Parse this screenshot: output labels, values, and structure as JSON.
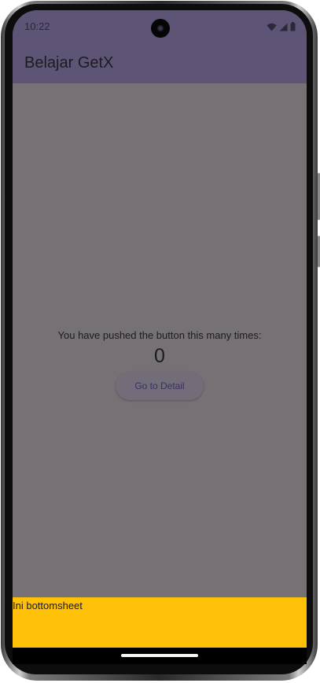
{
  "status_bar": {
    "time": "10:22",
    "icons": [
      "wifi-icon",
      "cellular-signal-icon",
      "battery-icon"
    ]
  },
  "app_bar": {
    "title": "Belajar GetX"
  },
  "main": {
    "counter_caption": "You have pushed the button this many times:",
    "counter_value": "0",
    "detail_button_label": "Go to Detail"
  },
  "bottom_sheet": {
    "text": "Ini bottomsheet",
    "color": "#ffc107"
  },
  "colors": {
    "app_bar": "#5e5576",
    "scrim_body": "#767174",
    "text": "#1d1b20"
  }
}
